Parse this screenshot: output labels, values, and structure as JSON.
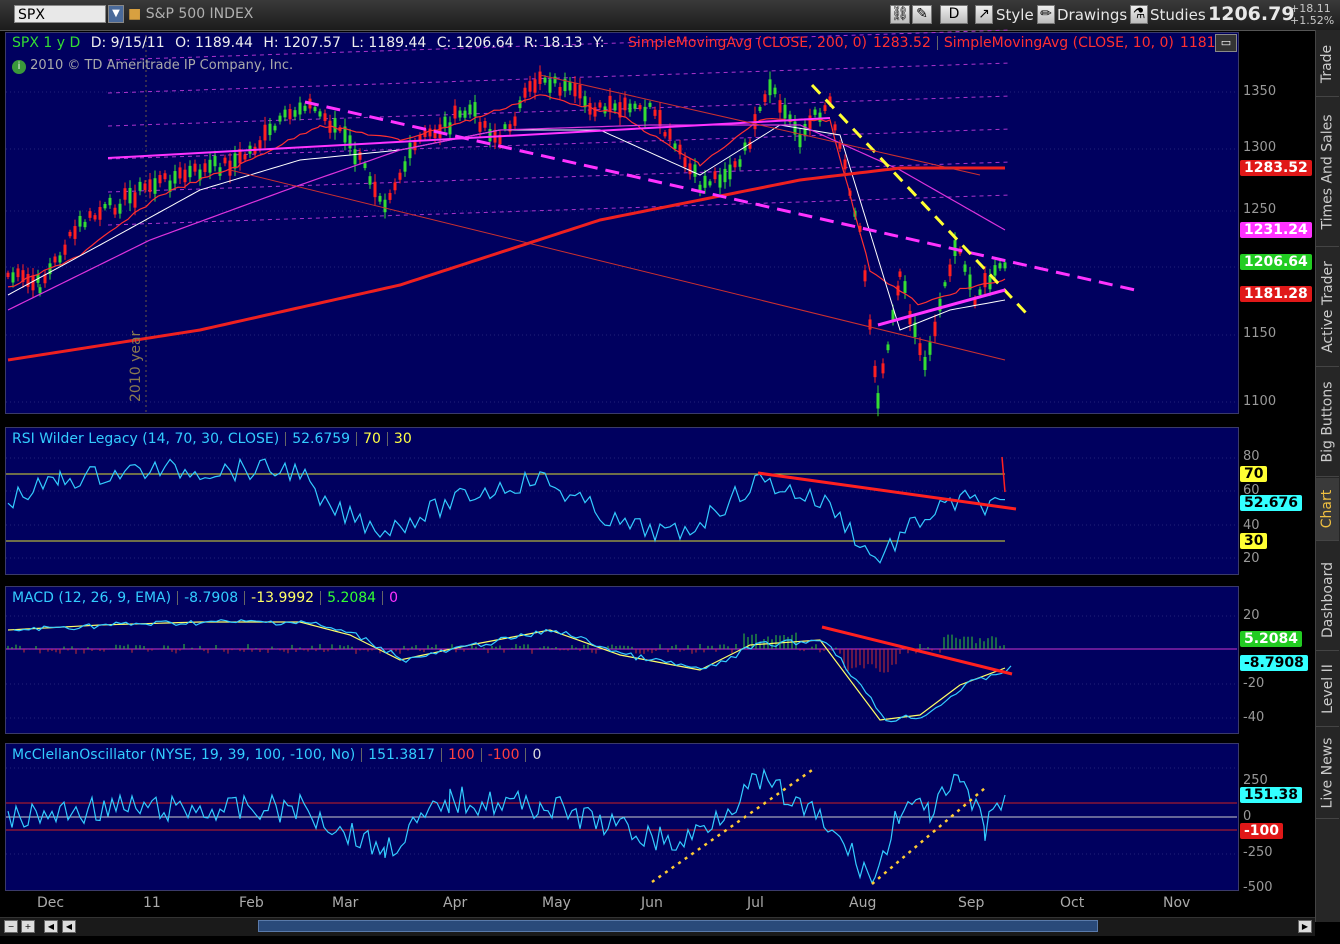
{
  "toolbar": {
    "symbol": "SPX",
    "symbol_name": "S&P 500 INDEX",
    "period_button": "D",
    "style_label": "Style",
    "drawings_label": "Drawings",
    "studies_label": "Studies",
    "last_price": "1206.79",
    "change_abs": "+18.11",
    "change_pct": "+1.52%"
  },
  "right_tabs": [
    "Trade",
    "Times And Sales",
    "Active Trader",
    "Big Buttons",
    "Chart",
    "Dashboard",
    "Level II",
    "Live News"
  ],
  "price_panel": {
    "header": {
      "sym": "SPX 1 y D",
      "date": "D: 9/15/11",
      "open": "O: 1189.44",
      "high": "H: 1207.57",
      "low": "L: 1189.44",
      "close": "C: 1206.64",
      "range": "R: 18.13",
      "y": "Y:",
      "sma200": "SimpleMovingAvg (CLOSE, 200, 0)",
      "sma200_val": "1283.52",
      "sma10": "SimpleMovingAvg (CLOSE, 10, 0)",
      "sma10_val": "1181.",
      "copyright": "2010 © TD Ameritrade IP Company, Inc.",
      "year_label": "2010 year"
    },
    "ticks": [
      "1350",
      "1300",
      "1250",
      "1200",
      "1150",
      "1100"
    ],
    "tags": {
      "sma200": "1283.52",
      "magenta": "1231.24",
      "close": "1206.64",
      "sma10": "1181.28"
    }
  },
  "rsi_panel": {
    "header": {
      "name": "RSI Wilder Legacy (14, 70, 30, CLOSE)",
      "value": "52.6759",
      "ob": "70",
      "os": "30"
    },
    "ticks": [
      "80",
      "60",
      "40",
      "20"
    ],
    "tags": {
      "ob": "70",
      "value": "52.676",
      "os": "30"
    }
  },
  "macd_panel": {
    "header": {
      "name": "MACD (12, 26, 9, EMA)",
      "value": "-8.7908",
      "avg": "-13.9992",
      "diff": "5.2084",
      "zero": "0"
    },
    "ticks": [
      "20",
      "-20",
      "-40"
    ],
    "tags": {
      "diff": "5.2084",
      "value": "-8.7908"
    }
  },
  "mcclellan_panel": {
    "header": {
      "name": "McClellanOscillator (NYSE, 19, 39, 100, -100, No)",
      "value": "151.3817",
      "ob": "100",
      "os": "-100",
      "zero": "0"
    },
    "ticks": [
      "250",
      "0",
      "-250",
      "-500"
    ],
    "tags": {
      "value": "151.38",
      "os": "-100"
    }
  },
  "x_axis": [
    "Dec",
    "11",
    "Feb",
    "Mar",
    "Apr",
    "May",
    "Jun",
    "Jul",
    "Aug",
    "Sep",
    "Oct",
    "Nov"
  ],
  "colors": {
    "panel_bg": "#00005f",
    "sma200": "#ff2020",
    "magenta": "#ff33ff",
    "yellow_trend": "#ffff33",
    "rsi": "#33ccff",
    "macd_avg": "#ffff66"
  }
}
